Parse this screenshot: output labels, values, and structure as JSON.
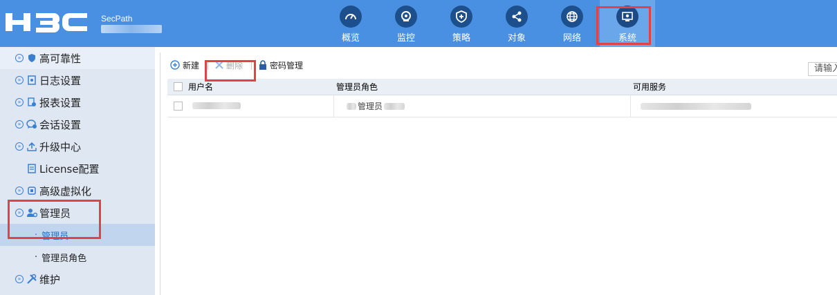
{
  "header": {
    "logo": "H3C",
    "device": "SecPath",
    "nav": [
      {
        "label": "概览",
        "icon": "gauge-icon"
      },
      {
        "label": "监控",
        "icon": "monitor-camera-icon"
      },
      {
        "label": "策略",
        "icon": "shield-plus-icon"
      },
      {
        "label": "对象",
        "icon": "share-icon"
      },
      {
        "label": "网络",
        "icon": "globe-icon"
      },
      {
        "label": "系统",
        "icon": "system-settings-icon",
        "active": true
      }
    ]
  },
  "sidebar": {
    "items": [
      {
        "label": "高可靠性",
        "icon": "shield-icon"
      },
      {
        "label": "日志设置",
        "icon": "log-icon"
      },
      {
        "label": "报表设置",
        "icon": "report-icon"
      },
      {
        "label": "会话设置",
        "icon": "chat-icon"
      },
      {
        "label": "升级中心",
        "icon": "upload-icon"
      },
      {
        "label": "License配置",
        "icon": "license-icon"
      },
      {
        "label": "高级虚拟化",
        "icon": "virtual-icon"
      },
      {
        "label": "管理员",
        "icon": "admin-user-icon"
      },
      {
        "label": "维护",
        "icon": "tools-icon"
      }
    ],
    "subitems": [
      {
        "label": "管理员",
        "active": true
      },
      {
        "label": "管理员角色"
      }
    ]
  },
  "toolbar": {
    "new_label": "新建",
    "delete_label": "删除",
    "password_label": "密码管理",
    "search_placeholder": "请输入"
  },
  "table": {
    "headers": [
      "用户名",
      "管理员角色",
      "可用服务"
    ],
    "rows": [
      {
        "role": "管理员"
      }
    ]
  }
}
